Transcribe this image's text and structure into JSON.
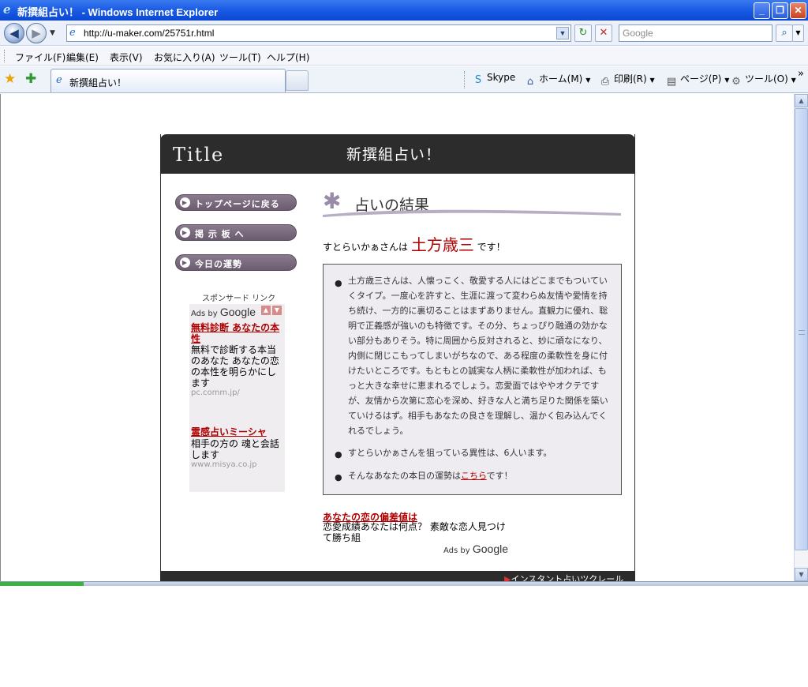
{
  "window": {
    "title": "新撰組占い！ - Windows Internet Explorer",
    "controls": {
      "minimize": "_",
      "maximize": "❐",
      "close": "✕"
    }
  },
  "address_bar": {
    "url": "http://u-maker.com/25751r.html",
    "search_placeholder": "Google"
  },
  "menu": [
    "ファイル(F)",
    "編集(E)",
    "表示(V)",
    "お気に入り(A)",
    "ツール(T)",
    "ヘルプ(H)"
  ],
  "tabs": [
    {
      "label": "新撰組占い！"
    }
  ],
  "command_bar": {
    "skype": "Skype",
    "home": "ホーム(M)",
    "print": "印刷(R)",
    "page": "ページ(P)",
    "tools": "ツール(O)",
    "more": "»"
  },
  "page": {
    "logo": "Title",
    "site_title": "新撰組占い！",
    "nav": [
      {
        "label": "トップページに戻る"
      },
      {
        "label": "掲 示 板 へ"
      },
      {
        "label": "今日の運勢"
      }
    ],
    "sponsor_heading": "スポンサード リンク",
    "ads_by_label": "Ads by",
    "google_label": "Google",
    "side_ads": [
      {
        "title": "無料診断 あなたの本性",
        "body": "無料で診断する本当のあなた あなたの恋の本性を明らかにします",
        "url": "pc.comm.jp/"
      },
      {
        "title": "霊感占いミーシャ",
        "body": "相手の方の 魂と会話します",
        "url": "www.misya.co.jp"
      }
    ],
    "result_heading": "占いの結果",
    "result_line": {
      "prefix": "すとらいかぁさんは",
      "name": "土方歳三",
      "suffix": "です！"
    },
    "details": [
      {
        "text": "土方歳三さんは、人懐っこく、敬愛する人にはどこまでもついていくタイプ。一度心を許すと、生涯に渡って変わらぬ友情や愛情を持ち続け、一方的に裏切ることはまずありません。直観力に優れ、聡明で正義感が強いのも特徴です。その分、ちょっぴり融通の効かない部分もありそう。特に周囲から反対されると、妙に頑なになり、内側に閉じこもってしまいがちなので、ある程度の柔軟性を身に付けたいところです。もともとの誠実な人柄に柔軟性が加われば、もっと大きな幸せに恵まれるでしょう。恋愛面ではややオクテですが、友情から次第に恋心を深め、好きな人と満ち足りた関係を築いていけるはず。相手もあなたの良さを理解し、温かく包み込んでくれるでしょう。"
      },
      {
        "text": "すとらいかぁさんを狙っている異性は、6人います。"
      },
      {
        "prefix": "そんなあなたの本日の運勢は",
        "link": "こちら",
        "suffix": "です！"
      }
    ],
    "bottom_ad": {
      "title": "あなたの恋の偏差値は",
      "body": "恋愛成績あなたは何点？ 素敵な恋人見つけて勝ち組"
    },
    "footer_link": "インスタント占いツクレール"
  },
  "colors": {
    "titlebar": "#1c5de6",
    "header": "#2c2c2c",
    "accent_red": "#b00000",
    "nav_pill": "#6b5c70",
    "box_bg": "#eeecf0"
  }
}
